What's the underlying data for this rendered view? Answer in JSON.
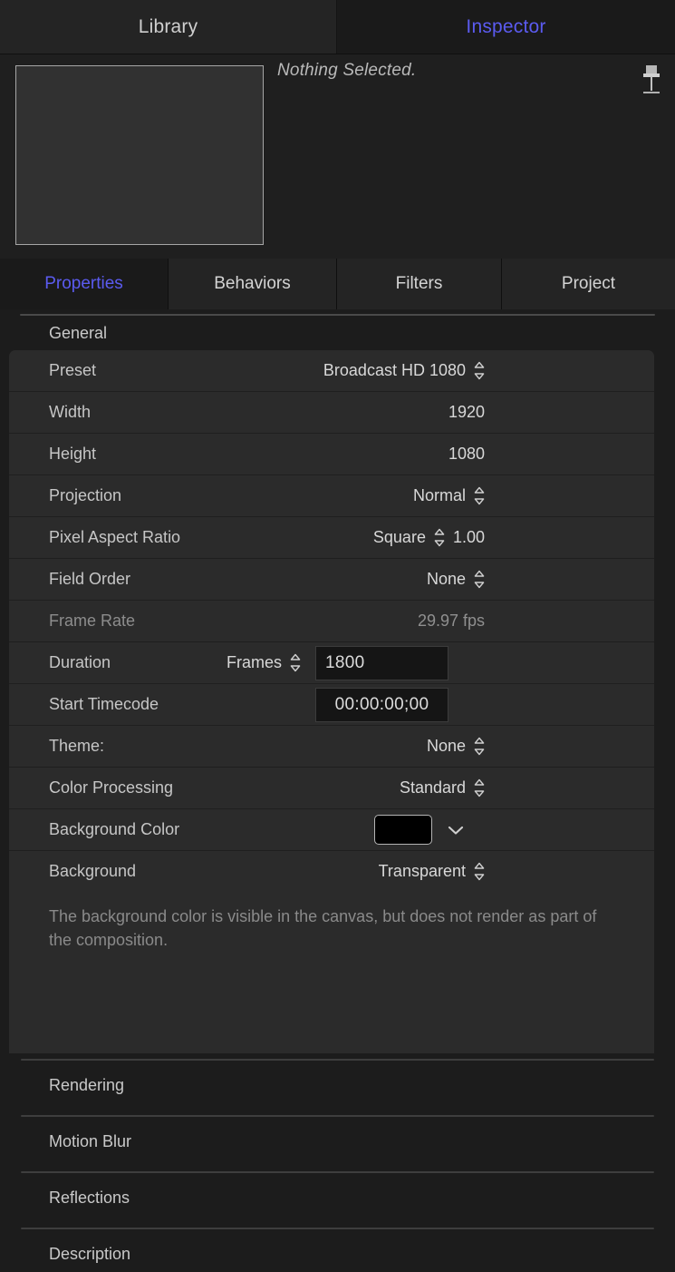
{
  "top_tabs": [
    {
      "label": "Library",
      "active": false
    },
    {
      "label": "Inspector",
      "active": true
    }
  ],
  "preview": {
    "status_text": "Nothing Selected.",
    "pin_icon": "pin-icon"
  },
  "section_tabs": [
    {
      "label": "Properties",
      "active": true
    },
    {
      "label": "Behaviors",
      "active": false
    },
    {
      "label": "Filters",
      "active": false
    },
    {
      "label": "Project",
      "active": false
    }
  ],
  "general": {
    "header": "General",
    "rows": {
      "preset": {
        "label": "Preset",
        "value": "Broadcast HD 1080"
      },
      "width": {
        "label": "Width",
        "value": "1920"
      },
      "height": {
        "label": "Height",
        "value": "1080"
      },
      "projection": {
        "label": "Projection",
        "value": "Normal"
      },
      "pixel_aspect": {
        "label": "Pixel Aspect Ratio",
        "value": "Square",
        "number": "1.00"
      },
      "field_order": {
        "label": "Field Order",
        "value": "None"
      },
      "frame_rate": {
        "label": "Frame Rate",
        "value": "29.97 fps"
      },
      "duration": {
        "label": "Duration",
        "unit": "Frames",
        "value": "1800"
      },
      "start_timecode": {
        "label": "Start Timecode",
        "value": "00:00:00;00"
      },
      "theme": {
        "label": "Theme:",
        "value": "None"
      },
      "color_processing": {
        "label": "Color Processing",
        "value": "Standard"
      },
      "background_color": {
        "label": "Background Color",
        "swatch_color": "#000000"
      },
      "background": {
        "label": "Background",
        "value": "Transparent"
      }
    },
    "note": "The background color is visible in the canvas, but does not render as part of the composition."
  },
  "collapsed_sections": [
    {
      "label": "Rendering"
    },
    {
      "label": "Motion Blur"
    },
    {
      "label": "Reflections"
    },
    {
      "label": "Description"
    }
  ],
  "colors": {
    "accent": "#5b5bf0",
    "row_bg": "#2b2b2b",
    "panel_bg": "#1c1c1c"
  }
}
